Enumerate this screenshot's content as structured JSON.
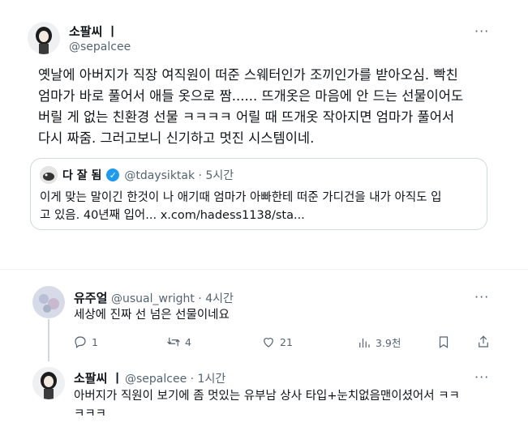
{
  "main_post": {
    "author_name": "소팔씨 ㅣ",
    "handle": "@sepalcee",
    "more": "···",
    "body_lines": [
      "옛날에 아버지가 직장 여직원이 떠준 스웨터인가 조끼인가를 받아오심. 빡친",
      "엄마가 바로 풀어서 애들 옷으로 짬...... 뜨개옷은 마음에 안 드는 선물이어도",
      "버릴 게 없는 친환경 선물 ㅋㅋㅋㅋ 어릴 때 뜨개옷 작아지면 엄마가 풀어서",
      "다시 짜줌. 그러고보니 신기하고 멋진 시스템이네."
    ]
  },
  "quote": {
    "author_name": "다 잘 됨",
    "verified": "✓",
    "meta": "@tdaysiktak · 5시간",
    "text_lines": [
      "이게 맞는 말이긴 한것이 나 애기때 엄마가 아빠한테 떠준 가디건을 내가 아직도 입",
      "고 있음. 40년째 입어... x.com/hadess1138/sta..."
    ]
  },
  "reply1": {
    "author_name": "유주얼",
    "meta": "@usual_wright · 4시간",
    "more": "···",
    "text": "세상에 진짜 선 넘은 선물이네요",
    "actions": {
      "reply_count": "1",
      "retweet_count": "4",
      "like_count": "21",
      "view_count": "3.9천"
    }
  },
  "reply2": {
    "author_name": "소팔씨 ㅣ",
    "meta": "@sepalcee · 1시간",
    "more": "···",
    "text_lines": [
      "아버지가 직원이 보기에 좀 멋있는 유부남 상사 타입+눈치없음맨이셨어서 ㅋㅋ",
      "ㅋㅋㅋ"
    ]
  },
  "colors": {
    "accent": "#1d9bf0",
    "muted": "#536471",
    "border": "#cfd9de"
  }
}
